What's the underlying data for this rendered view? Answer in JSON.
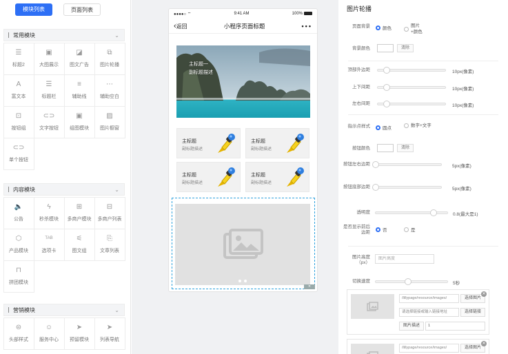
{
  "top_tabs": {
    "active": "模块列表",
    "inactive": "页面列表"
  },
  "sections": [
    {
      "title": "常用模块",
      "items": [
        {
          "icon": "list-icon",
          "glyph": "☰",
          "label": "标题2"
        },
        {
          "icon": "image-icon",
          "glyph": "▣",
          "label": "大图展示"
        },
        {
          "icon": "image-text-ad-icon",
          "glyph": "◪",
          "label": "图文广告"
        },
        {
          "icon": "carousel-icon",
          "glyph": "⧉",
          "label": "图片轮播"
        },
        {
          "icon": "rich-text-icon",
          "glyph": "A",
          "label": "富文本"
        },
        {
          "icon": "title-bar-icon",
          "glyph": "☰",
          "label": "标题栏"
        },
        {
          "icon": "divider-line-icon",
          "glyph": "≡",
          "label": "辅助线"
        },
        {
          "icon": "spacer-icon",
          "glyph": "⋯",
          "label": "辅助空白"
        },
        {
          "icon": "button-group-icon",
          "glyph": "⊡",
          "label": "按钮组"
        },
        {
          "icon": "text-button-icon",
          "glyph": "⊂⊃",
          "label": "文字按钮"
        },
        {
          "icon": "image-module-icon",
          "glyph": "▣",
          "label": "组图模块"
        },
        {
          "icon": "image-gallery-icon",
          "glyph": "▨",
          "label": "图片橱窗"
        },
        {
          "icon": "single-button-icon",
          "glyph": "⊂⊃",
          "label": "单个按钮"
        }
      ]
    },
    {
      "title": "内容模块",
      "items": [
        {
          "icon": "announcement-icon",
          "glyph": "🔈",
          "label": "公告"
        },
        {
          "icon": "flash-sale-icon",
          "glyph": "ϟ",
          "label": "秒杀模块"
        },
        {
          "icon": "multi-merchant-icon",
          "glyph": "⊞",
          "label": "多商户模块"
        },
        {
          "icon": "merchant-list-icon",
          "glyph": "⊟",
          "label": "多商户列表"
        },
        {
          "icon": "product-icon",
          "glyph": "⬡",
          "label": "产品模块"
        },
        {
          "icon": "tab-card-icon",
          "glyph": "TAB",
          "label": "选项卡"
        },
        {
          "icon": "article-group-icon",
          "glyph": "⚟",
          "label": "图文组"
        },
        {
          "icon": "article-list-icon",
          "glyph": "⎘",
          "label": "文章列表"
        },
        {
          "icon": "coupon-icon",
          "glyph": "⊓",
          "label": "拼团模块"
        }
      ]
    },
    {
      "title": "营销模块",
      "items": [
        {
          "icon": "header-style-icon",
          "glyph": "⊜",
          "label": "头部样式"
        },
        {
          "icon": "service-center-icon",
          "glyph": "☺",
          "label": "服务中心"
        },
        {
          "icon": "appointment-icon",
          "glyph": "➤",
          "label": "预留模块"
        },
        {
          "icon": "list-nav-icon",
          "glyph": "➤",
          "label": "列表导航"
        }
      ]
    }
  ],
  "phone": {
    "status_left": "●●●●○ ⌔",
    "time": "9:41 AM",
    "battery": "100%",
    "back": "返回",
    "page_title": "小程序页面标题",
    "menu_dots": "•••",
    "banner_line1": "主标题一",
    "banner_line2": "副标题描述",
    "cards": [
      {
        "title": "主标题",
        "sub": "副标题描述"
      },
      {
        "title": "主标题",
        "sub": "副标题描述"
      },
      {
        "title": "主标题",
        "sub": "副标题描述"
      },
      {
        "title": "主标题",
        "sub": "副标题描述"
      }
    ]
  },
  "settings": {
    "panel_title": "图片轮播",
    "page_bg_label": "页面背景",
    "opt_color": "颜色",
    "opt_image_color": "图片+颜色",
    "bg_color_label": "背景颜色",
    "clear": "清除",
    "margin_top_label": "顶部外边距",
    "margin_top_value": "10px(像素)",
    "padding_vertical_label": "上下间距",
    "padding_vertical_value": "10px(像素)",
    "padding_horizontal_label": "左右间距",
    "padding_horizontal_value": "10px(像素)",
    "indicator_style_label": "指示点样式",
    "opt_dot": "圆点",
    "opt_number_text": "数字+文字",
    "button_color_label": "按钮颜色",
    "btn_lr_margin_label": "按钮左右边距",
    "btn_lr_margin_value": "5px(像素)",
    "btn_bottom_margin_label": "按钮底部边距",
    "btn_bottom_margin_value": "5px(像素)",
    "opacity_label": "透明度",
    "opacity_value": "0.8(最大是1)",
    "show_border_label": "是否显示前后边距",
    "opt_yes": "否",
    "opt_no": "是",
    "img_height_label": "图片高度（px）",
    "img_height_placeholder": "图片高度",
    "switch_speed_label": "切换速度",
    "switch_speed_value": "5秒",
    "image_items": [
      {
        "path": "/lillypage/resource/images/",
        "select_image": "选择图片",
        "link_placeholder": "请选择链接或输入链接地址",
        "select_link": "选择链接",
        "desc_label": "图片描述",
        "desc_value": "1"
      },
      {
        "path": "/lillypage/resource/images/",
        "select_image": "选择图片"
      }
    ]
  }
}
